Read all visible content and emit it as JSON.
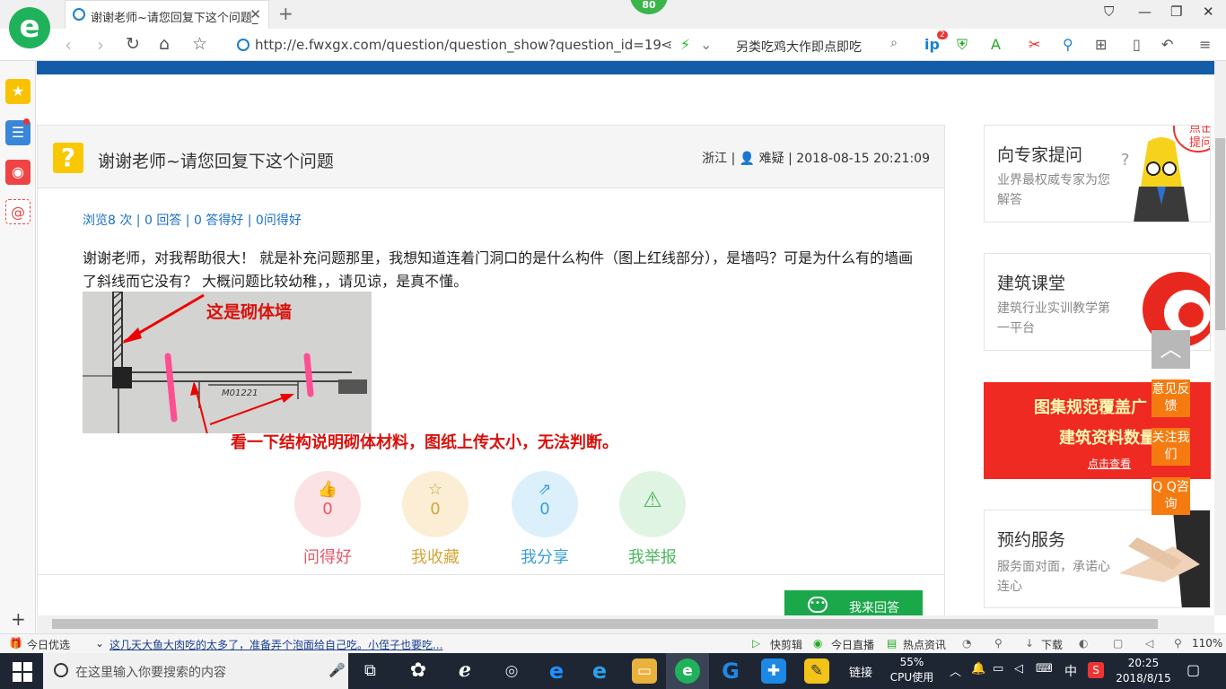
{
  "browser": {
    "tab_title": "谢谢老师~请您回复下这个问题_",
    "badge": "80",
    "url": "http://e.fwxgx.com/question/question_show?question_id=19",
    "search_text": "另类吃鸡大作即点即吃",
    "toolbar_badge": "2",
    "logo_char": "e"
  },
  "question": {
    "title": "谢谢老师~请您回复下这个问题",
    "meta_location": "浙江",
    "meta_level": "难疑",
    "meta_time": "2018-08-15 20:21:09",
    "stats": "浏览8 次 | 0 回答 | 0 答得好 | 0问得好",
    "body": "谢谢老师，对我帮助很大！  就是补充问题那里，我想知道连着门洞口的是什么构件（图上红线部分），是墙吗？可是为什么有的墙画了斜线而它没有？  大概问题比较幼稚，，请见谅，是真不懂。",
    "image_label": "M01221",
    "annotation_wall": "这是砌体墙",
    "annotation_note": "看一下结构说明砌体材料，图纸上传太小，无法判断。",
    "actions": [
      {
        "label": "问得好",
        "count": "0",
        "icon": "thumbs-up-icon",
        "color": "#e8576a",
        "bg": "#fbe3e5"
      },
      {
        "label": "我收藏",
        "count": "0",
        "icon": "star-icon",
        "color": "#d4a63c",
        "bg": "#fbeed5"
      },
      {
        "label": "我分享",
        "count": "0",
        "icon": "share-icon",
        "color": "#3a9fd8",
        "bg": "#dcf0fb"
      },
      {
        "label": "我举报",
        "count": "",
        "icon": "warning-icon",
        "color": "#4bb65e",
        "bg": "#e0f4e3"
      }
    ],
    "answer_button": "我来回答"
  },
  "sidebar": {
    "expert": {
      "title": "向专家提问",
      "desc": "业界最权威专家为您解答",
      "bubble": "点击提问"
    },
    "classroom": {
      "title": "建筑课堂",
      "desc": "建筑行业实训教学第一平台"
    },
    "promo": {
      "line1": "图集规范覆盖广",
      "line2": "建筑资料数量",
      "link": "点击查看"
    },
    "booking": {
      "title": "预约服务",
      "desc": "服务面对面，承诺心连心"
    }
  },
  "float_buttons": {
    "feedback": "意见反馈",
    "follow": "关注我们",
    "qq": "Q Q咨询"
  },
  "statusbar": {
    "today": "今日优选",
    "news": "这几天大鱼大肉吃的太多了，准备弄个泡面给自己吃。小侄子也要吃...",
    "clip": "快剪辑",
    "live": "今日直播",
    "hot": "热点资讯",
    "download": "下载",
    "zoom": "110%"
  },
  "taskbar": {
    "search_placeholder": "在这里输入你要搜索的内容",
    "link_label": "链接",
    "cpu_percent": "55%",
    "cpu_label": "CPU使用",
    "ime": "中",
    "time": "20:25",
    "date": "2018/8/15"
  },
  "colors": {
    "accent_blue": "#145ba8",
    "answer_green": "#1aa84a",
    "float_orange": "#f57b10",
    "annotation_red": "#d9110c"
  }
}
